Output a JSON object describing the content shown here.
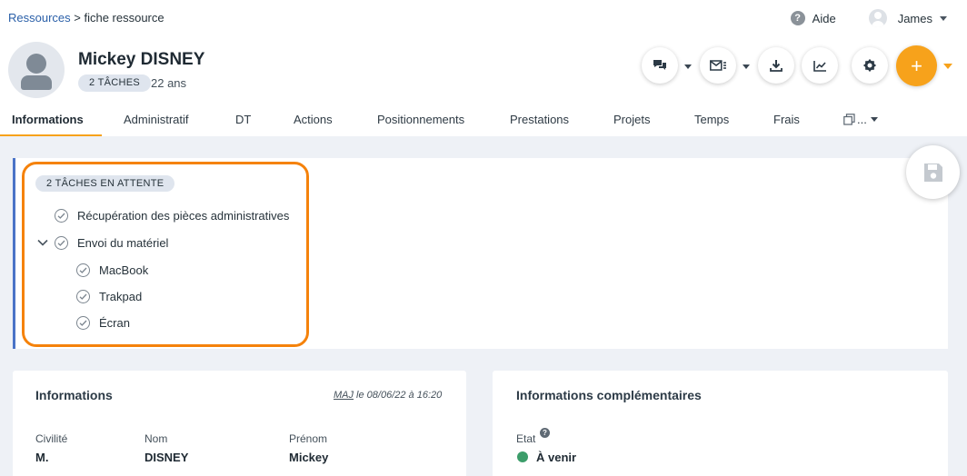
{
  "breadcrumb": {
    "parent": "Ressources",
    "separator": " > ",
    "current": "fiche ressource"
  },
  "topbar": {
    "help_label": "Aide",
    "user_name": "James"
  },
  "header": {
    "name": "Mickey DISNEY",
    "tasks_badge": "2 TÂCHES",
    "age": "22 ans",
    "add_label": "+"
  },
  "tabs": [
    "Informations",
    "Administratif",
    "DT",
    "Actions",
    "Positionnements",
    "Prestations",
    "Projets",
    "Temps",
    "Frais",
    "..."
  ],
  "tasks_panel": {
    "badge": "2 TÂCHES EN ATTENTE",
    "tasks": [
      {
        "label": "Récupération des pièces administratives"
      },
      {
        "label": "Envoi du matériel",
        "subtasks": [
          {
            "label": "MacBook"
          },
          {
            "label": "Trakpad"
          },
          {
            "label": "Écran"
          }
        ]
      }
    ]
  },
  "info_card": {
    "title": "Informations",
    "maj_prefix": "MAJ",
    "maj_text": " le 08/06/22 à 16:20",
    "fields": [
      {
        "label": "Civilité",
        "value": "M."
      },
      {
        "label": "Nom",
        "value": "DISNEY"
      },
      {
        "label": "Prénom",
        "value": "Mickey"
      }
    ]
  },
  "extra_card": {
    "title": "Informations complémentaires",
    "status_label": "Etat",
    "status_help": "?",
    "status_value": "À venir"
  },
  "colors": {
    "accent": "#f7a21b",
    "highlight_border": "#f5820b",
    "panel_rule": "#4a73c7",
    "status_upcoming": "#3c9d6a"
  },
  "icons": [
    "help-icon",
    "user-avatar-icon",
    "chat-icon",
    "mail-icon",
    "download-icon",
    "chart-icon",
    "gear-icon",
    "plus-icon",
    "copy-icon",
    "save-icon",
    "check-icon",
    "chevron-down-icon"
  ]
}
